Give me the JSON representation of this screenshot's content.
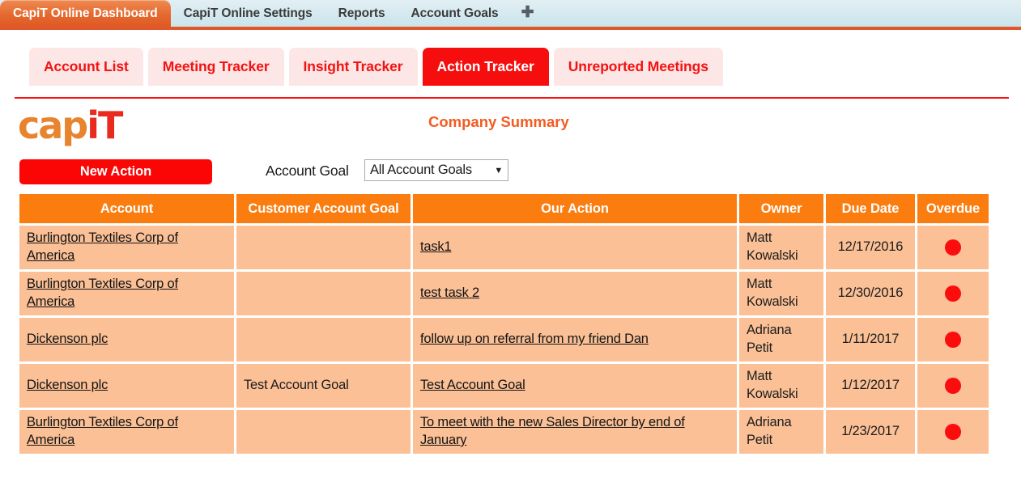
{
  "browser": {
    "tabs": [
      {
        "label": "CapiT Online Dashboard",
        "active": true
      },
      {
        "label": "CapiT Online Settings",
        "active": false
      },
      {
        "label": "Reports",
        "active": false
      },
      {
        "label": "Account Goals",
        "active": false
      }
    ],
    "new_tab_icon": "plus-icon",
    "new_tab_glyph": "✚"
  },
  "subtabs": [
    {
      "label": "Account List",
      "active": false
    },
    {
      "label": "Meeting Tracker",
      "active": false
    },
    {
      "label": "Insight Tracker",
      "active": false
    },
    {
      "label": "Action Tracker",
      "active": true
    },
    {
      "label": "Unreported Meetings",
      "active": false
    }
  ],
  "header": {
    "logo_part1": "cap",
    "logo_part2": "iT",
    "page_title": "Company Summary"
  },
  "toolbar": {
    "new_action_label": "New Action",
    "account_goal_label": "Account Goal",
    "account_goal_value": "All Account Goals",
    "account_goal_caret": "▼",
    "account_goal_options": [
      "All Account Goals"
    ]
  },
  "table": {
    "columns": [
      "Account",
      "Customer Account Goal",
      "Our Action",
      "Owner",
      "Due Date",
      "Overdue"
    ],
    "rows": [
      {
        "account": "Burlington Textiles Corp of America",
        "customer_account_goal": "",
        "our_action": "task1",
        "owner": "Matt Kowalski",
        "due_date": "12/17/2016",
        "overdue": true
      },
      {
        "account": "Burlington Textiles Corp of America",
        "customer_account_goal": "",
        "our_action": "test task 2",
        "owner": "Matt Kowalski",
        "due_date": "12/30/2016",
        "overdue": true
      },
      {
        "account": "Dickenson plc",
        "customer_account_goal": "",
        "our_action": "follow up on referral from my friend Dan",
        "owner": "Adriana Petit",
        "due_date": "1/11/2017",
        "overdue": true
      },
      {
        "account": "Dickenson plc",
        "customer_account_goal": "Test Account Goal",
        "our_action": "Test Account Goal",
        "owner": "Matt Kowalski",
        "due_date": "1/12/2017",
        "overdue": true
      },
      {
        "account": "Burlington Textiles Corp of America",
        "customer_account_goal": "",
        "our_action": "To meet with the new Sales Director by end of January",
        "owner": "Adriana Petit",
        "due_date": "1/23/2017",
        "overdue": true
      }
    ]
  },
  "colors": {
    "accent_orange": "#fb7d10",
    "brand_red": "#fb0505",
    "row_peach": "#fbc096",
    "logo_orange": "#e8832e",
    "logo_red": "#ea2a1e",
    "overdue_dot": "#fb0d0d",
    "title_orange": "#f35b21",
    "chrome_blue": "#cbe4ec",
    "chrome_tab_orange": "#e5692f"
  }
}
